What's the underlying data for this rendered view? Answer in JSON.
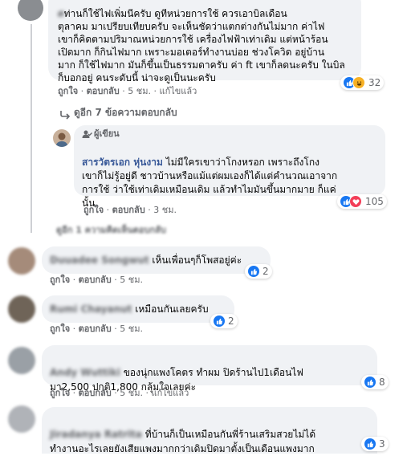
{
  "comment_top": {
    "author": "ศ",
    "text": "ท่านก็ใช้ไฟเพิ่มนีครับ ดูทีหน่วยการใช้ ควรเอาบิลเดือน\nตุลาคม มาเปรียบเทียบครับ จะเห็นชัดว่าแตกต่างกันไม่มาก ค่าไฟ\nเขาก็คิดตามปริมาณหน่วยการใช้ เครื่องไฟฟ้าเท่าเดิม แต่หน้าร้อน\nเปิดมาก ก็กินไฟมาก เพราะมอเตอร์ทำงานบ่อย ช่วงโควิด อยู่บ้าน\nมาก ก็ใช้ไฟมาก มันก็ขึ้นเป็นธรรมดาครับ ค่า ft เขาก็ลดนะครับ ในบิล\nก็บอกอยู่ คนระดับนี้ น่าจะดูเป็นนะครับ",
    "like": "ถูกใจ",
    "reply": "ตอบกลับ",
    "time": "5 ชม.",
    "edited": "แก้ไขแล้ว",
    "reactions": "32"
  },
  "replies_toggle": "ดูอีก 7 ข้อความตอบกลับ",
  "author_reply": {
    "badge": "ผู้เขียน",
    "name": "สารวัตรเอก หุ่นงาม",
    "text_first": "ไม่มีใครเขาว่าโกงหรอก เพราะถึงโกง",
    "text_rest": "เขาก็ไม่รู้อยู่ดี ชาวบ้านหรือแม้แต่ผมเองก็ได้แต่คำนวณเอาจาก\nการใช้ ว่าใช้เท่าเดิมเหมือนเดิม แล้วทำไมมันขึ้นมากมาย ก็แค่\nนั้น",
    "like": "ถูกใจ",
    "reply": "ตอบกลับ",
    "time": "3 ชม.",
    "reactions": "105"
  },
  "hidden_replies": "ดูอีก 1 ความคิดเห็นตอบกลับ",
  "comments": [
    {
      "name": "Duuadee Songwut",
      "text": "เห็นเพื่อนๆก็โพสอยู่ค่ะ",
      "like": "ถูกใจ",
      "reply": "ตอบกลับ",
      "time": "5 ชม.",
      "reactions": "2"
    },
    {
      "name": "Rumi Chayanut",
      "text": "เหมือนกันเลยครับ",
      "like": "ถูกใจ",
      "reply": "ตอบกลับ",
      "time": "5 ชม.",
      "reactions": "2"
    },
    {
      "name": "Andy Wuttiki",
      "text_first": "ของนุ่กแพงโคตร ทำผม ปิดร้านไป1เดือนไฟ",
      "text_rest": "มา2,500 ปกติ1,800 กลุ้มใจเลยค่ะ",
      "like": "ถูกใจ",
      "reply": "ตอบกลับ",
      "time": "5 ชม.",
      "edited": "แก้ไขแล้ว",
      "reactions": "8"
    },
    {
      "name": "Jiradanya Ratrita",
      "text_first": "ที่บ้านก็เป็นเหมือนกันพี่ร้านเสริมสวยไม่ได้",
      "text_rest": "ทำงานอะไรเลยยังเสียแพงมากกว่าเดิมปิดมาตั้งเป็นเดือนแพงมาก",
      "reactions": "3"
    }
  ],
  "colors": {
    "like": "#1877f2",
    "love": "#f33e58",
    "haha": "#f7b125",
    "bubble": "#f0f2f5",
    "meta": "#65676b"
  }
}
